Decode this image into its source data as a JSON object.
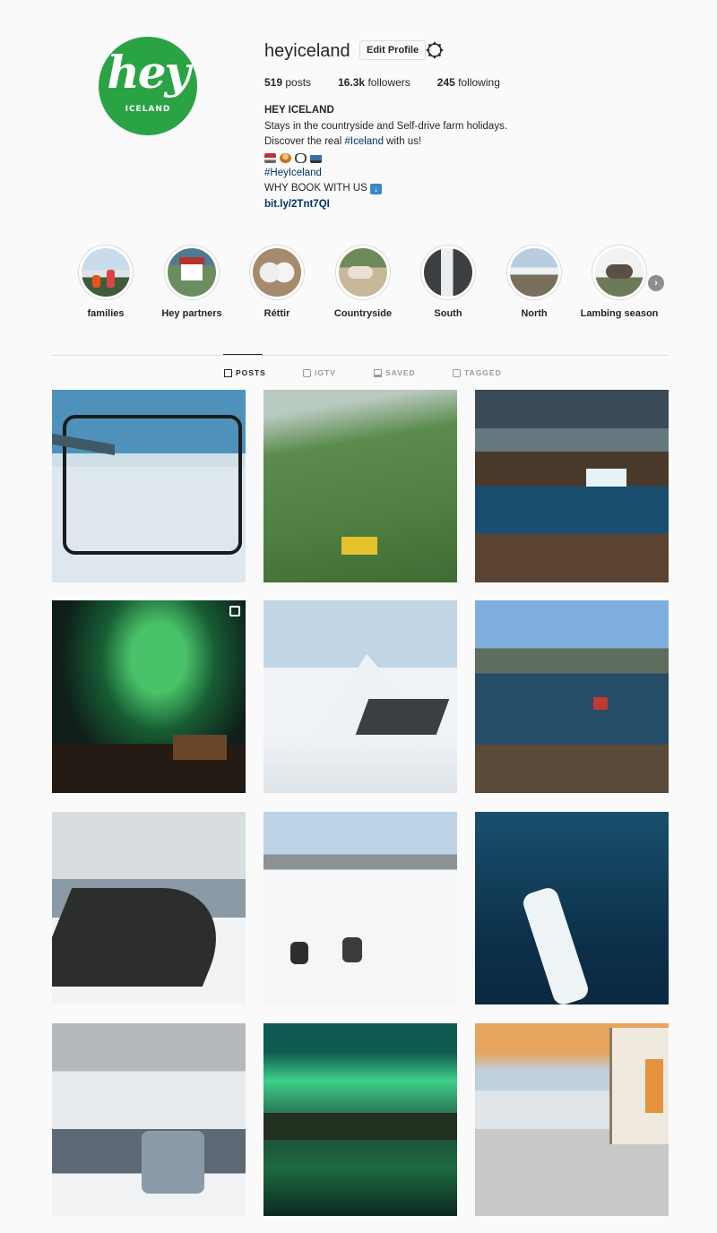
{
  "profile": {
    "username": "heyiceland",
    "edit_label": "Edit Profile",
    "logo_text": "hey",
    "logo_subtext": "ICELAND",
    "stats": {
      "posts_count": "519",
      "posts_label": "posts",
      "followers_count": "16.3k",
      "followers_label": "followers",
      "following_count": "245",
      "following_label": "following"
    },
    "bio": {
      "name": "HEY ICELAND",
      "line1": "Stays in the countryside and Self-drive farm holidays.",
      "line2_prefix": "Discover the real ",
      "line2_tag": "#Iceland",
      "line2_suffix": " with us!",
      "hashtag": "#HeyIceland",
      "why": "WHY BOOK WITH US",
      "link": "bit.ly/2Tnt7QI"
    }
  },
  "highlights": [
    {
      "label": "families"
    },
    {
      "label": "Hey partners"
    },
    {
      "label": "Réttir"
    },
    {
      "label": "Countryside"
    },
    {
      "label": "South"
    },
    {
      "label": "North"
    },
    {
      "label": "Lambing season"
    }
  ],
  "tabs": [
    {
      "label": "POSTS",
      "active": true
    },
    {
      "label": "IGTV",
      "active": false
    },
    {
      "label": "SAVED",
      "active": false
    },
    {
      "label": "TAGGED",
      "active": false
    }
  ],
  "colors": {
    "brand_green": "#2aa344",
    "link_blue": "#003569"
  }
}
